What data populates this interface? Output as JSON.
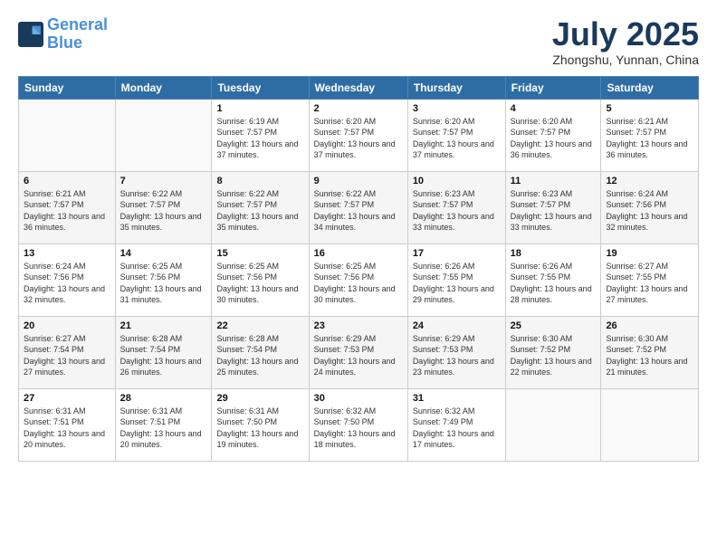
{
  "header": {
    "logo_line1": "General",
    "logo_line2": "Blue",
    "month": "July 2025",
    "location": "Zhongshu, Yunnan, China"
  },
  "weekdays": [
    "Sunday",
    "Monday",
    "Tuesday",
    "Wednesday",
    "Thursday",
    "Friday",
    "Saturday"
  ],
  "weeks": [
    [
      {
        "day": "",
        "info": ""
      },
      {
        "day": "",
        "info": ""
      },
      {
        "day": "1",
        "info": "Sunrise: 6:19 AM\nSunset: 7:57 PM\nDaylight: 13 hours and 37 minutes."
      },
      {
        "day": "2",
        "info": "Sunrise: 6:20 AM\nSunset: 7:57 PM\nDaylight: 13 hours and 37 minutes."
      },
      {
        "day": "3",
        "info": "Sunrise: 6:20 AM\nSunset: 7:57 PM\nDaylight: 13 hours and 37 minutes."
      },
      {
        "day": "4",
        "info": "Sunrise: 6:20 AM\nSunset: 7:57 PM\nDaylight: 13 hours and 36 minutes."
      },
      {
        "day": "5",
        "info": "Sunrise: 6:21 AM\nSunset: 7:57 PM\nDaylight: 13 hours and 36 minutes."
      }
    ],
    [
      {
        "day": "6",
        "info": "Sunrise: 6:21 AM\nSunset: 7:57 PM\nDaylight: 13 hours and 36 minutes."
      },
      {
        "day": "7",
        "info": "Sunrise: 6:22 AM\nSunset: 7:57 PM\nDaylight: 13 hours and 35 minutes."
      },
      {
        "day": "8",
        "info": "Sunrise: 6:22 AM\nSunset: 7:57 PM\nDaylight: 13 hours and 35 minutes."
      },
      {
        "day": "9",
        "info": "Sunrise: 6:22 AM\nSunset: 7:57 PM\nDaylight: 13 hours and 34 minutes."
      },
      {
        "day": "10",
        "info": "Sunrise: 6:23 AM\nSunset: 7:57 PM\nDaylight: 13 hours and 33 minutes."
      },
      {
        "day": "11",
        "info": "Sunrise: 6:23 AM\nSunset: 7:57 PM\nDaylight: 13 hours and 33 minutes."
      },
      {
        "day": "12",
        "info": "Sunrise: 6:24 AM\nSunset: 7:56 PM\nDaylight: 13 hours and 32 minutes."
      }
    ],
    [
      {
        "day": "13",
        "info": "Sunrise: 6:24 AM\nSunset: 7:56 PM\nDaylight: 13 hours and 32 minutes."
      },
      {
        "day": "14",
        "info": "Sunrise: 6:25 AM\nSunset: 7:56 PM\nDaylight: 13 hours and 31 minutes."
      },
      {
        "day": "15",
        "info": "Sunrise: 6:25 AM\nSunset: 7:56 PM\nDaylight: 13 hours and 30 minutes."
      },
      {
        "day": "16",
        "info": "Sunrise: 6:25 AM\nSunset: 7:56 PM\nDaylight: 13 hours and 30 minutes."
      },
      {
        "day": "17",
        "info": "Sunrise: 6:26 AM\nSunset: 7:55 PM\nDaylight: 13 hours and 29 minutes."
      },
      {
        "day": "18",
        "info": "Sunrise: 6:26 AM\nSunset: 7:55 PM\nDaylight: 13 hours and 28 minutes."
      },
      {
        "day": "19",
        "info": "Sunrise: 6:27 AM\nSunset: 7:55 PM\nDaylight: 13 hours and 27 minutes."
      }
    ],
    [
      {
        "day": "20",
        "info": "Sunrise: 6:27 AM\nSunset: 7:54 PM\nDaylight: 13 hours and 27 minutes."
      },
      {
        "day": "21",
        "info": "Sunrise: 6:28 AM\nSunset: 7:54 PM\nDaylight: 13 hours and 26 minutes."
      },
      {
        "day": "22",
        "info": "Sunrise: 6:28 AM\nSunset: 7:54 PM\nDaylight: 13 hours and 25 minutes."
      },
      {
        "day": "23",
        "info": "Sunrise: 6:29 AM\nSunset: 7:53 PM\nDaylight: 13 hours and 24 minutes."
      },
      {
        "day": "24",
        "info": "Sunrise: 6:29 AM\nSunset: 7:53 PM\nDaylight: 13 hours and 23 minutes."
      },
      {
        "day": "25",
        "info": "Sunrise: 6:30 AM\nSunset: 7:52 PM\nDaylight: 13 hours and 22 minutes."
      },
      {
        "day": "26",
        "info": "Sunrise: 6:30 AM\nSunset: 7:52 PM\nDaylight: 13 hours and 21 minutes."
      }
    ],
    [
      {
        "day": "27",
        "info": "Sunrise: 6:31 AM\nSunset: 7:51 PM\nDaylight: 13 hours and 20 minutes."
      },
      {
        "day": "28",
        "info": "Sunrise: 6:31 AM\nSunset: 7:51 PM\nDaylight: 13 hours and 20 minutes."
      },
      {
        "day": "29",
        "info": "Sunrise: 6:31 AM\nSunset: 7:50 PM\nDaylight: 13 hours and 19 minutes."
      },
      {
        "day": "30",
        "info": "Sunrise: 6:32 AM\nSunset: 7:50 PM\nDaylight: 13 hours and 18 minutes."
      },
      {
        "day": "31",
        "info": "Sunrise: 6:32 AM\nSunset: 7:49 PM\nDaylight: 13 hours and 17 minutes."
      },
      {
        "day": "",
        "info": ""
      },
      {
        "day": "",
        "info": ""
      }
    ]
  ]
}
